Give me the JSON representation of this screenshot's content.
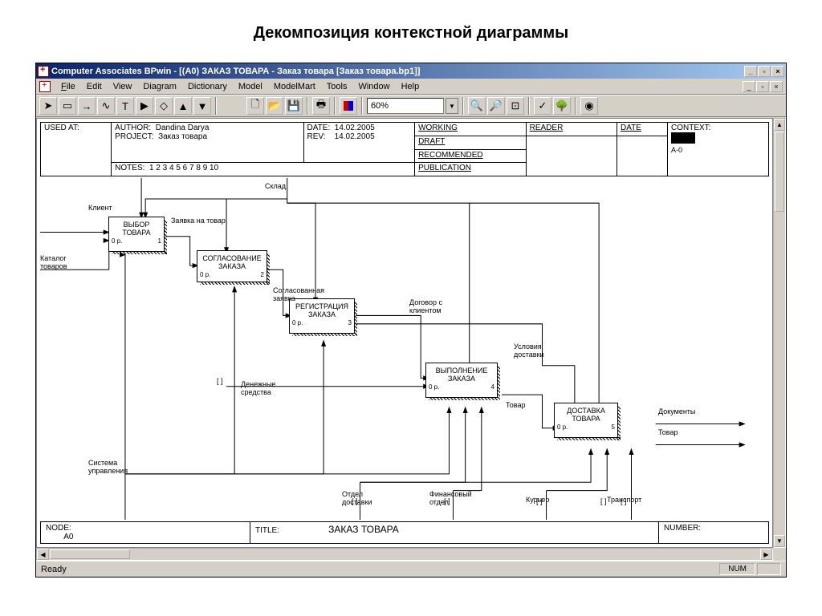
{
  "page_title": "Декомпозиция контекстной диаграммы",
  "window": {
    "title": "Computer Associates BPwin - [(A0) ЗАКАЗ ТОВАРА  - Заказ товара  [Заказ товара.bp1]]"
  },
  "menu": {
    "file": "File",
    "edit": "Edit",
    "view": "View",
    "diagram": "Diagram",
    "dictionary": "Dictionary",
    "model": "Model",
    "modelmart": "ModelMart",
    "tools": "Tools",
    "window": "Window",
    "help": "Help"
  },
  "toolbar": {
    "zoom": "60%"
  },
  "header": {
    "used_at": "USED AT:",
    "author_lbl": "AUTHOR:",
    "author": "Dandina Darya",
    "project_lbl": "PROJECT:",
    "project": "Заказ товара",
    "notes_lbl": "NOTES:",
    "notes": "1  2  3  4  5  6  7  8  9  10",
    "date_lbl": "DATE:",
    "date": "14.02.2005",
    "rev_lbl": "REV:",
    "rev": "14.02.2005",
    "working": "WORKING",
    "draft": "DRAFT",
    "recommended": "RECOMMENDED",
    "publication": "PUBLICATION",
    "reader": "READER",
    "dateh": "DATE",
    "context": "CONTEXT:",
    "context_id": "A-0"
  },
  "footer": {
    "node_lbl": "NODE:",
    "node": "A0",
    "title_lbl": "TITLE:",
    "title": "ЗАКАЗ ТОВАРА",
    "number_lbl": "NUMBER:"
  },
  "boxes": {
    "b1": {
      "t1": "ВЫБОР",
      "t2": "ТОВАРА",
      "cost": "0 р.",
      "num": "1"
    },
    "b2": {
      "t1": "СОГЛАСОВАНИЕ",
      "t2": "ЗАКАЗА",
      "cost": "0 р.",
      "num": "2"
    },
    "b3": {
      "t1": "РЕГИСТРАЦИЯ",
      "t2": "ЗАКАЗА",
      "cost": "0 р.",
      "num": "3"
    },
    "b4": {
      "t1": "ВЫПОЛНЕНИЕ",
      "t2": "ЗАКАЗА",
      "cost": "0 р.",
      "num": "4"
    },
    "b5": {
      "t1": "ДОСТАВКА",
      "t2": "ТОВАРА",
      "cost": "0 р.",
      "num": "5"
    }
  },
  "labels": {
    "klient": "Клиент",
    "sklad": "Склад",
    "zayavka": "Заявка на товар",
    "katalog1": "Каталог",
    "katalog2": "товаров",
    "sogl1": "Согласованная",
    "sogl2": "заявка",
    "dogovor1": "Договор с",
    "dogovor2": "клиентом",
    "uslov1": "Условия",
    "uslov2": "доставки",
    "denezh1": "Денежные",
    "denezh2": "средства",
    "tovar": "Товар",
    "dokumenty": "Документы",
    "tovar_out": "Товар",
    "sistema1": "Система",
    "sistema2": "управления",
    "otdel1": "Отдел",
    "otdel2": "доставки",
    "fin1": "Финансовый",
    "fin2": "отдел",
    "kuryer": "Курьер",
    "transport": "Транспорт"
  },
  "status": {
    "ready": "Ready",
    "num": "NUM"
  }
}
